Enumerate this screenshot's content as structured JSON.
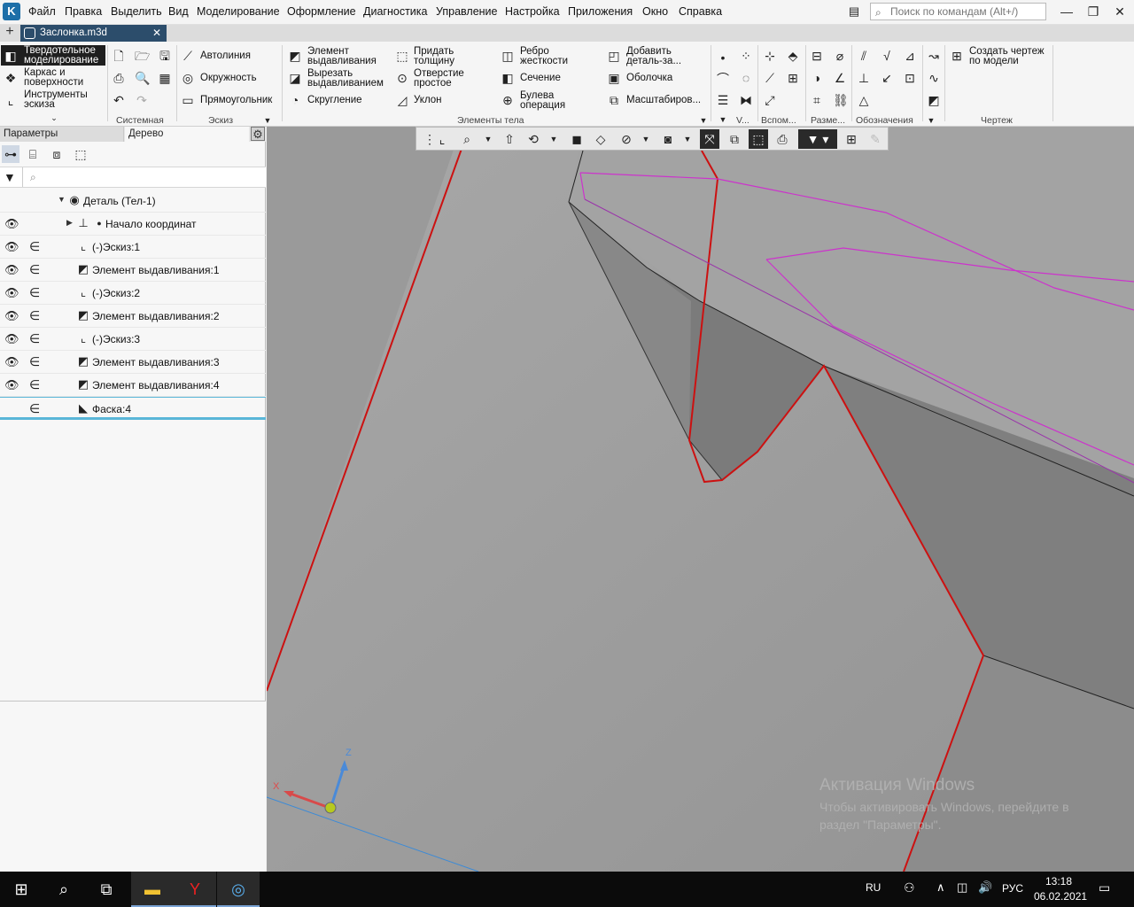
{
  "menubar": {
    "items": [
      "Файл",
      "Правка",
      "Выделить",
      "Вид",
      "Моделирование",
      "Оформление",
      "Диагностика",
      "Управление",
      "Настройка",
      "Приложения",
      "Окно",
      "Справка"
    ],
    "search_placeholder": "Поиск по командам (Alt+/)"
  },
  "tabs": {
    "document": "Заслонка.m3d"
  },
  "ribbon": {
    "modes": [
      "Твердотельное моделирование",
      "Каркас и поверхности",
      "Инструменты эскиза"
    ],
    "mode_lines": [
      [
        "Твердотельное",
        "моделирование"
      ],
      [
        "Каркас и",
        "поверхности"
      ],
      [
        "Инструменты",
        "эскиза"
      ]
    ],
    "sketch": [
      "Автолиния",
      "Окружность",
      "Прямоугольник"
    ],
    "body_col1": [
      [
        "Элемент",
        "выдавливания"
      ],
      [
        "Вырезать",
        "выдавливанием"
      ],
      [
        "Скругление"
      ]
    ],
    "body_col2": [
      [
        "Придать",
        "толщину"
      ],
      [
        "Отверстие",
        "простое"
      ],
      [
        "Уклон"
      ]
    ],
    "body_col3": [
      [
        "Ребро",
        "жесткости"
      ],
      [
        "Сечение"
      ],
      [
        "Булева",
        "операция"
      ]
    ],
    "body_col4": [
      [
        "Добавить",
        "деталь-за..."
      ],
      [
        "Оболочка"
      ],
      [
        "Масштабиров..."
      ]
    ],
    "drawing": [
      "Создать чертеж",
      "по модели"
    ],
    "groups": [
      "Системная",
      "Эскиз",
      "Элементы тела",
      "V...",
      "Вспом...",
      "Разме...",
      "Обозначения",
      "Чертеж"
    ]
  },
  "panel": {
    "tab_params": "Параметры",
    "tab_tree": "Дерево",
    "search_placeholder": "⌕",
    "tree": [
      {
        "label": "Деталь (Тел-1)",
        "level": 0,
        "eye": false,
        "incl": false
      },
      {
        "label": "Начало координат",
        "level": 1,
        "eye": true,
        "incl": false
      },
      {
        "label": "(-)Эскиз:1",
        "level": 2,
        "eye": true,
        "incl": true
      },
      {
        "label": "Элемент выдавливания:1",
        "level": 2,
        "eye": true,
        "incl": true
      },
      {
        "label": "(-)Эскиз:2",
        "level": 2,
        "eye": true,
        "incl": true
      },
      {
        "label": "Элемент выдавливания:2",
        "level": 2,
        "eye": true,
        "incl": true
      },
      {
        "label": "(-)Эскиз:3",
        "level": 2,
        "eye": true,
        "incl": true
      },
      {
        "label": "Элемент выдавливания:3",
        "level": 2,
        "eye": true,
        "incl": true
      },
      {
        "label": "Элемент выдавливания:4",
        "level": 2,
        "eye": true,
        "incl": true
      },
      {
        "label": "Фаска:4",
        "level": 2,
        "eye": false,
        "incl": true
      }
    ]
  },
  "viewport": {
    "axis_x": "X",
    "axis_z": "Z",
    "watermark_title": "Активация Windows",
    "watermark_text": "Чтобы активировать Windows, перейдите в раздел \"Параметры\"."
  },
  "taskbar": {
    "lang": "RU",
    "input_lang": "РУС",
    "time": "13:18",
    "date": "06.02.2021"
  },
  "colors": {
    "edge_red": "#cc1111",
    "sketch_magenta": "#cc33cc",
    "axis_blue": "#3a8ad8",
    "ribbon_active": "#1f1f1f"
  }
}
